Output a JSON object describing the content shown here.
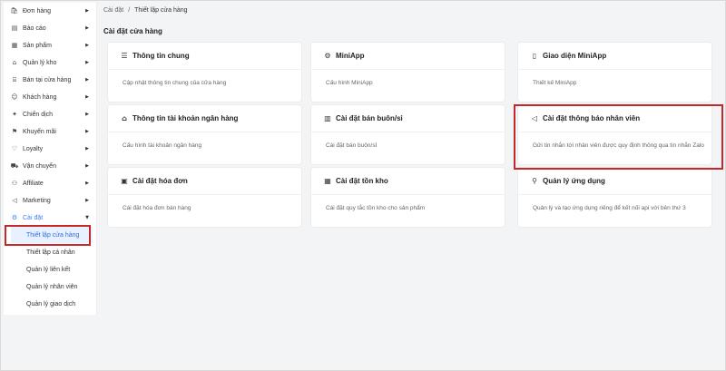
{
  "sidebar": {
    "items": [
      {
        "label": "Đơn hàng",
        "icon": "shopping-bag-icon",
        "glyph": "🛍",
        "has_arrow": true
      },
      {
        "label": "Báo cáo",
        "icon": "clipboard-icon",
        "glyph": "▤",
        "has_arrow": true
      },
      {
        "label": "Sản phẩm",
        "icon": "box-icon",
        "glyph": "▦",
        "has_arrow": true
      },
      {
        "label": "Quản lý kho",
        "icon": "warehouse-icon",
        "glyph": "⌂",
        "has_arrow": true
      },
      {
        "label": "Bán tại cửa hàng",
        "icon": "store-icon",
        "glyph": "⌸",
        "has_arrow": true
      },
      {
        "label": "Khách hàng",
        "icon": "users-icon",
        "glyph": "☺",
        "has_arrow": true
      },
      {
        "label": "Chiến dịch",
        "icon": "campaign-icon",
        "glyph": "✦",
        "has_arrow": true
      },
      {
        "label": "Khuyến mãi",
        "icon": "gift-icon",
        "glyph": "⚑",
        "has_arrow": true
      },
      {
        "label": "Loyalty",
        "icon": "heart-icon",
        "glyph": "♡",
        "has_arrow": true
      },
      {
        "label": "Vận chuyển",
        "icon": "truck-icon",
        "glyph": "⛟",
        "has_arrow": true
      },
      {
        "label": "Affiliate",
        "icon": "link-icon",
        "glyph": "⚇",
        "has_arrow": true
      },
      {
        "label": "Marketing",
        "icon": "megaphone-icon",
        "glyph": "◁",
        "has_arrow": true
      },
      {
        "label": "Cài đặt",
        "icon": "gear-icon",
        "glyph": "⚙",
        "has_arrow": true,
        "expanded": true
      }
    ],
    "sub_items": [
      {
        "label": "Thiết lập cửa hàng",
        "selected": true
      },
      {
        "label": "Thiết lập cá nhân"
      },
      {
        "label": "Quản lý liên kết"
      },
      {
        "label": "Quản lý nhân viên"
      },
      {
        "label": "Quản lý giao dịch"
      }
    ],
    "arrow_right": "▶",
    "arrow_down": "▼"
  },
  "breadcrumb": {
    "root": "Cài đặt",
    "separator": "/",
    "current": "Thiết lập cửa hàng"
  },
  "section_title": "Cài đặt cửa hàng",
  "cards": [
    {
      "title": "Thông tin chung",
      "desc": "Cập nhật thông tin chung của cửa hàng",
      "icon": "list-icon",
      "glyph": "☰"
    },
    {
      "title": "MiniApp",
      "desc": "Cấu hình MiniApp",
      "icon": "gear-icon",
      "glyph": "⚙"
    },
    {
      "title": "Giao diện MiniApp",
      "desc": "Thiết kế MiniApp",
      "icon": "phone-icon",
      "glyph": "▯"
    },
    {
      "title": "Thông tin tài khoản ngân hàng",
      "desc": "Cấu hình tài khoản ngân hàng",
      "icon": "bank-icon",
      "glyph": "⌂"
    },
    {
      "title": "Cài đặt bán buôn/sỉ",
      "desc": "Cài đặt bán buôn/sỉ",
      "icon": "barcode-icon",
      "glyph": "▥"
    },
    {
      "title": "Cài đặt thông báo nhân viên",
      "desc": "Gửi tin nhắn tới nhân viên được quy định thông qua tin nhắn Zalo",
      "icon": "megaphone-icon",
      "glyph": "◁"
    },
    {
      "title": "Cài đặt hóa đơn",
      "desc": "Cài đặt hóa đơn bán hàng",
      "icon": "invoice-icon",
      "glyph": "▣"
    },
    {
      "title": "Cài đặt tồn kho",
      "desc": "Cài đặt quy tắc tồn kho cho sản phẩm",
      "icon": "inventory-icon",
      "glyph": "▦"
    },
    {
      "title": "Quản lý ứng dụng",
      "desc": "Quản lý và tạo ứng dụng riêng để kết nối api với bên thứ 3",
      "icon": "key-icon",
      "glyph": "⚲"
    }
  ],
  "colors": {
    "accent": "#3b82f6",
    "highlight": "#c62828",
    "selected_bg": "#e8f1ff"
  }
}
